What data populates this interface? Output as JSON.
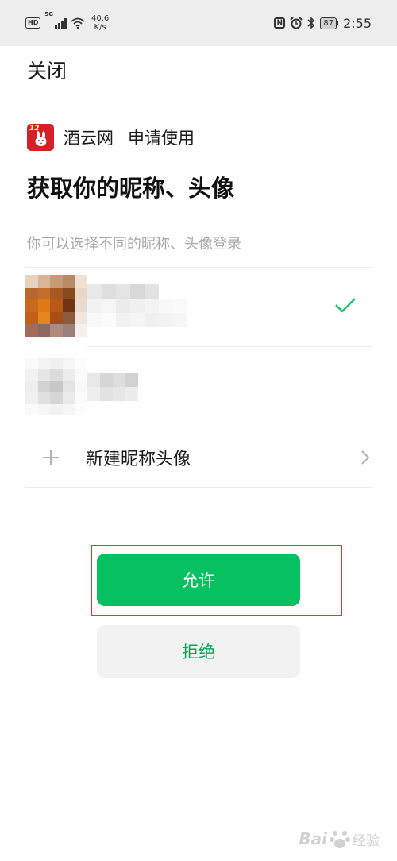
{
  "status_bar": {
    "hd_badge": "HD",
    "network_type": "5G",
    "speed_value": "40.6",
    "speed_unit": "K/s",
    "nfc_label": "N",
    "battery_level": "87",
    "time": "2:55",
    "icons": [
      "hd-icon",
      "signal-icon",
      "wifi-icon",
      "nfc-icon",
      "alarm-icon",
      "bluetooth-icon",
      "battery-icon"
    ]
  },
  "header": {
    "close_label": "关闭"
  },
  "app": {
    "icon_badge": "12",
    "name": "酒云网",
    "request_text": "申请使用"
  },
  "title": "获取你的昵称、头像",
  "subtitle": "你可以选择不同的昵称、头像登录",
  "accounts": [
    {
      "selected": true,
      "icon": "check-icon"
    },
    {
      "selected": false
    }
  ],
  "new_profile": {
    "label": "新建昵称头像",
    "icon": "plus-icon",
    "arrow_icon": "chevron-right-icon"
  },
  "buttons": {
    "allow": "允许",
    "reject": "拒绝"
  },
  "watermark": {
    "brand": "Bai",
    "brand_suffix": "经验"
  },
  "colors": {
    "primary_green": "#07c160",
    "highlight_red": "#d43c3c",
    "status_bar_bg": "#ededed"
  }
}
